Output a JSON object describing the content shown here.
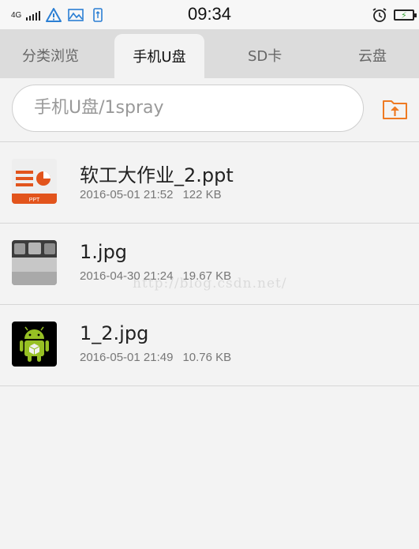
{
  "status_bar": {
    "network": "4G",
    "time": "09:34",
    "icons": [
      "signal-icon",
      "warning-icon",
      "gallery-icon",
      "usb-icon",
      "alarm-icon",
      "battery-icon"
    ]
  },
  "tabs": [
    {
      "label": "分类浏览",
      "active": false
    },
    {
      "label": "手机U盘",
      "active": true
    },
    {
      "label": "SD卡",
      "active": false
    },
    {
      "label": "云盘",
      "active": false
    }
  ],
  "path_bar": {
    "path": "手机U盘/1spray",
    "button_icon": "folder-up-icon"
  },
  "files": [
    {
      "name": "软工大作业_2.ppt",
      "date": "2016-05-01 21:52",
      "size": "122 KB",
      "icon": "ppt-file-icon"
    },
    {
      "name": "1.jpg",
      "date": "2016-04-30 21:24",
      "size": "19.67 KB",
      "icon": "image-thumbnail"
    },
    {
      "name": "1_2.jpg",
      "date": "2016-05-01 21:49",
      "size": "10.76 KB",
      "icon": "android-image-thumbnail"
    }
  ],
  "watermark": "http://blog.csdn.net/",
  "colors": {
    "accent": "#ee7a22",
    "background": "#f3f3f3",
    "tabbar": "#dcdcdc"
  }
}
